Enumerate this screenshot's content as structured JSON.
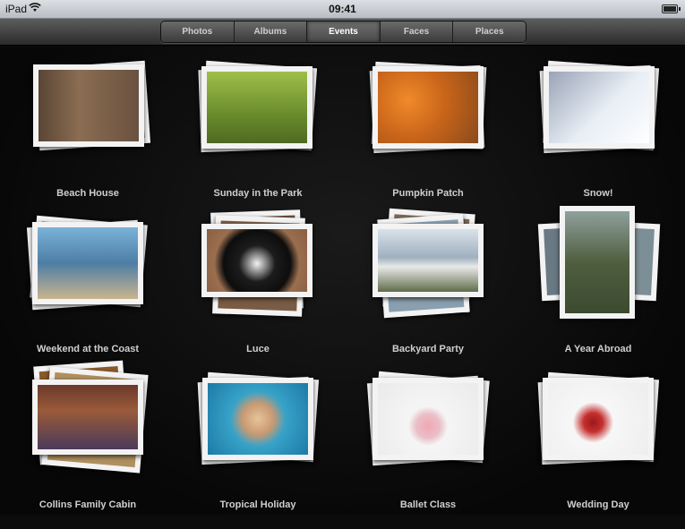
{
  "status_bar": {
    "carrier": "iPad",
    "time": "09:41"
  },
  "tabs": [
    {
      "label": "Photos",
      "active": false
    },
    {
      "label": "Albums",
      "active": false
    },
    {
      "label": "Events",
      "active": true
    },
    {
      "label": "Faces",
      "active": false
    },
    {
      "label": "Places",
      "active": false
    }
  ],
  "events": [
    {
      "title": "Beach House"
    },
    {
      "title": "Sunday in the Park"
    },
    {
      "title": "Pumpkin Patch"
    },
    {
      "title": "Snow!"
    },
    {
      "title": "Weekend at the Coast"
    },
    {
      "title": "Luce"
    },
    {
      "title": "Backyard Party"
    },
    {
      "title": "A Year Abroad"
    },
    {
      "title": "Collins Family Cabin"
    },
    {
      "title": "Tropical Holiday"
    },
    {
      "title": "Ballet Class"
    },
    {
      "title": "Wedding Day"
    }
  ]
}
